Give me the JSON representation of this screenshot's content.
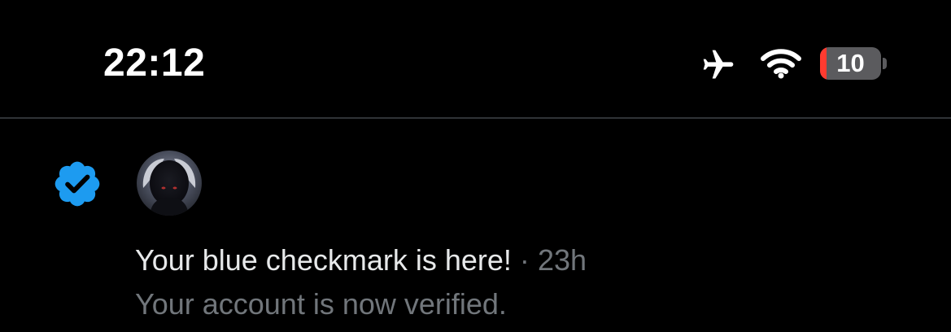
{
  "status_bar": {
    "time": "22:12",
    "battery_level": "10",
    "battery_fraction": 0.1,
    "icons": [
      "airplane-icon",
      "wifi-icon",
      "battery-icon"
    ],
    "battery_low_color": "#ff3b30"
  },
  "notification": {
    "type_icon": "verified-badge-icon",
    "badge_color": "#1d9bf0",
    "title": "Your blue checkmark is here!",
    "separator": "·",
    "time_ago": "23h",
    "body": "Your account is now verified."
  }
}
